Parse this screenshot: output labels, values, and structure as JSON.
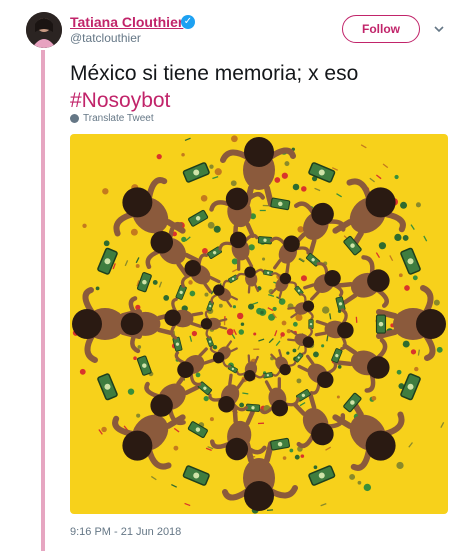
{
  "tweet": {
    "display_name": "Tatiana Clouthier",
    "handle": "@tatclouthier",
    "follow_label": "Follow",
    "text": "México si tiene memoria; x eso",
    "hashtag": "#Nosoybot",
    "translate_label": "Translate Tweet",
    "timestamp": "9:16 PM - 21 Jun 2018"
  },
  "icons": {
    "verified": "verified-badge-icon",
    "more": "chevron-down-icon",
    "translate": "globe-icon"
  },
  "colors": {
    "accent": "#c1246a",
    "verified": "#1da1f2",
    "thread_line": "#e6a6c1",
    "media_background": "#f7d11b"
  }
}
